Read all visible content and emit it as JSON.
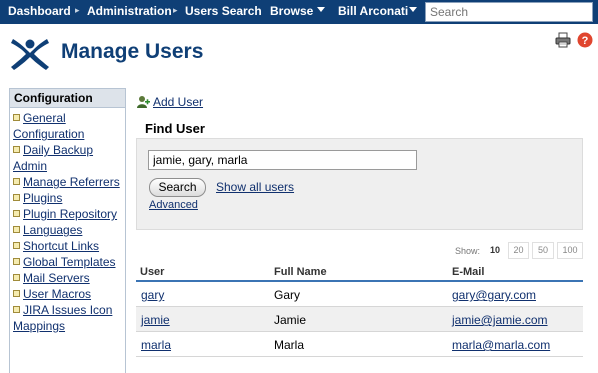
{
  "nav": {
    "items": [
      {
        "label": "Dashboard"
      },
      {
        "label": "Administration"
      },
      {
        "label": "Users Search"
      },
      {
        "label": "Browse"
      },
      {
        "label": "Bill Arconati"
      }
    ],
    "search_placeholder": "Search",
    "bar_color": "#0f3f76"
  },
  "header": {
    "title": "Manage Users",
    "print_icon": "printer-icon",
    "help_icon": "help-icon"
  },
  "sidebar": {
    "title": "Configuration",
    "items": [
      {
        "label": "General Configuration"
      },
      {
        "label": "Daily Backup Admin"
      },
      {
        "label": "Manage Referrers"
      },
      {
        "label": "Plugins"
      },
      {
        "label": "Plugin Repository"
      },
      {
        "label": "Languages"
      },
      {
        "label": "Shortcut Links"
      },
      {
        "label": "Global Templates"
      },
      {
        "label": "Mail Servers"
      },
      {
        "label": "User Macros"
      },
      {
        "label": "JIRA Issues Icon Mappings"
      }
    ]
  },
  "main": {
    "add_user": "Add User",
    "find_title": "Find User",
    "find_value": "jamie, gary, marla",
    "search_button": "Search",
    "show_all": "Show all users",
    "advanced": "Advanced",
    "show_label": "Show:",
    "page_sizes": [
      "10",
      "20",
      "50",
      "100"
    ],
    "selected_page_size": "10",
    "columns": [
      "User",
      "Full Name",
      "E-Mail"
    ],
    "rows": [
      {
        "user": "gary",
        "full_name": "Gary",
        "email": "gary@gary.com"
      },
      {
        "user": "jamie",
        "full_name": "Jamie",
        "email": "jamie@jamie.com"
      },
      {
        "user": "marla",
        "full_name": "Marla",
        "email": "marla@marla.com"
      }
    ]
  }
}
